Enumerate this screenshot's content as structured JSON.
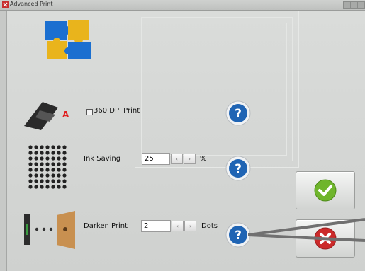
{
  "window": {
    "title": "Advanced Print"
  },
  "options": {
    "dpi": {
      "label": "360 DPI Print",
      "checked": false
    },
    "ink_saving": {
      "label": "Ink Saving",
      "value": "25",
      "unit": "%"
    },
    "darken_print": {
      "label": "Darken Print",
      "value": "2",
      "unit": "Dots"
    }
  },
  "spinner": {
    "down": "‹",
    "up": "›"
  },
  "icons": {
    "app": "app-icon",
    "puzzle": "puzzle-pieces-icon",
    "printer": "handheld-printer-icon",
    "dots": "dot-matrix-icon",
    "darken": "darken-print-icon",
    "help": "question-mark-icon",
    "ok": "checkmark-icon",
    "cancel": "cancel-icon"
  },
  "colors": {
    "help_blue": "#1f64b4",
    "ok_green": "#6fb52c",
    "cancel_red": "#cc2a2a"
  }
}
